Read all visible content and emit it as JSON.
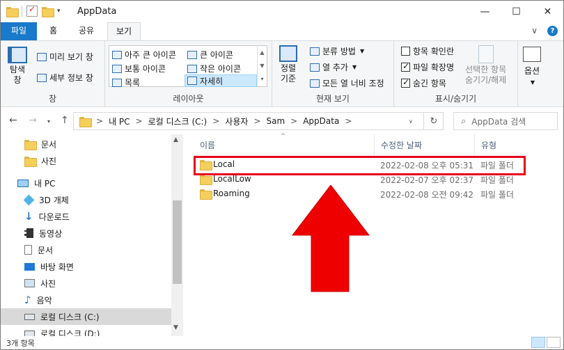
{
  "window": {
    "title": "AppData",
    "buttons": [
      "—",
      "☐",
      "✕"
    ]
  },
  "ribbon_tabs": {
    "file": "파일",
    "home": "홈",
    "share": "공유",
    "view": "보기",
    "expand": "∨",
    "help": "?"
  },
  "ribbon": {
    "pane_group": {
      "nav_pane": "탐색\n창",
      "preview": "미리 보기 창",
      "details": "세부 정보 창",
      "label": "창"
    },
    "layout_group": {
      "items": [
        "아주 큰 아이콘",
        "큰 아이콘",
        "보통 아이콘",
        "작은 아이콘",
        "목록",
        "자세히"
      ],
      "label": "레이아웃"
    },
    "current_view_group": {
      "sort": "정렬\n기준",
      "group_by": "분류 방법",
      "add_column": "열 추가",
      "fit_columns": "모든 열 너비 조정",
      "label": "현재 보기"
    },
    "show_hide_group": {
      "item_checkbox": "항목 확인란",
      "file_ext": "파일 확장명",
      "hidden_items": "숨긴 항목",
      "hide_selected": "선택한 항목\n숨기기/해제",
      "label": "표시/숨기기",
      "item_checkbox_checked": false,
      "file_ext_checked": true,
      "hidden_items_checked": true
    },
    "options": {
      "label": "옵션"
    }
  },
  "address": {
    "breadcrumb": [
      "내 PC",
      "로컬 디스크 (C:)",
      "사용자",
      "Sam",
      "AppData"
    ],
    "separator": ">",
    "search_placeholder": "AppData 검색"
  },
  "nav_pane": {
    "items": [
      {
        "label": "문서",
        "icon": "folder-icon"
      },
      {
        "label": "사진",
        "icon": "folder-icon"
      },
      {
        "label": "내 PC",
        "icon": "pc-icon"
      },
      {
        "label": "3D 개체",
        "icon": "cube-icon"
      },
      {
        "label": "다운로드",
        "icon": "download-icon"
      },
      {
        "label": "동영상",
        "icon": "video-icon"
      },
      {
        "label": "문서",
        "icon": "document-icon"
      },
      {
        "label": "바탕 화면",
        "icon": "desktop-icon"
      },
      {
        "label": "사진",
        "icon": "picture-icon"
      },
      {
        "label": "음악",
        "icon": "music-icon"
      },
      {
        "label": "로컬 디스크 (C:)",
        "icon": "drive-icon"
      },
      {
        "label": "로컬 디스크 (D:)",
        "icon": "drive-icon"
      }
    ]
  },
  "file_list": {
    "columns": [
      "이름",
      "수정한 날짜",
      "유형"
    ],
    "rows": [
      {
        "name": "Local",
        "modified": "2022-02-08 오후 05:31",
        "type": "파일 폴더"
      },
      {
        "name": "LocalLow",
        "modified": "2022-02-07 오후 02:37",
        "type": "파일 폴더"
      },
      {
        "name": "Roaming",
        "modified": "2022-02-08 오전 09:42",
        "type": "파일 폴더"
      }
    ]
  },
  "status": {
    "item_count": "3개 항목"
  },
  "colors": {
    "file_tab": "#1979ca",
    "highlight": "#e8001c",
    "selection": "#cce8ff"
  }
}
